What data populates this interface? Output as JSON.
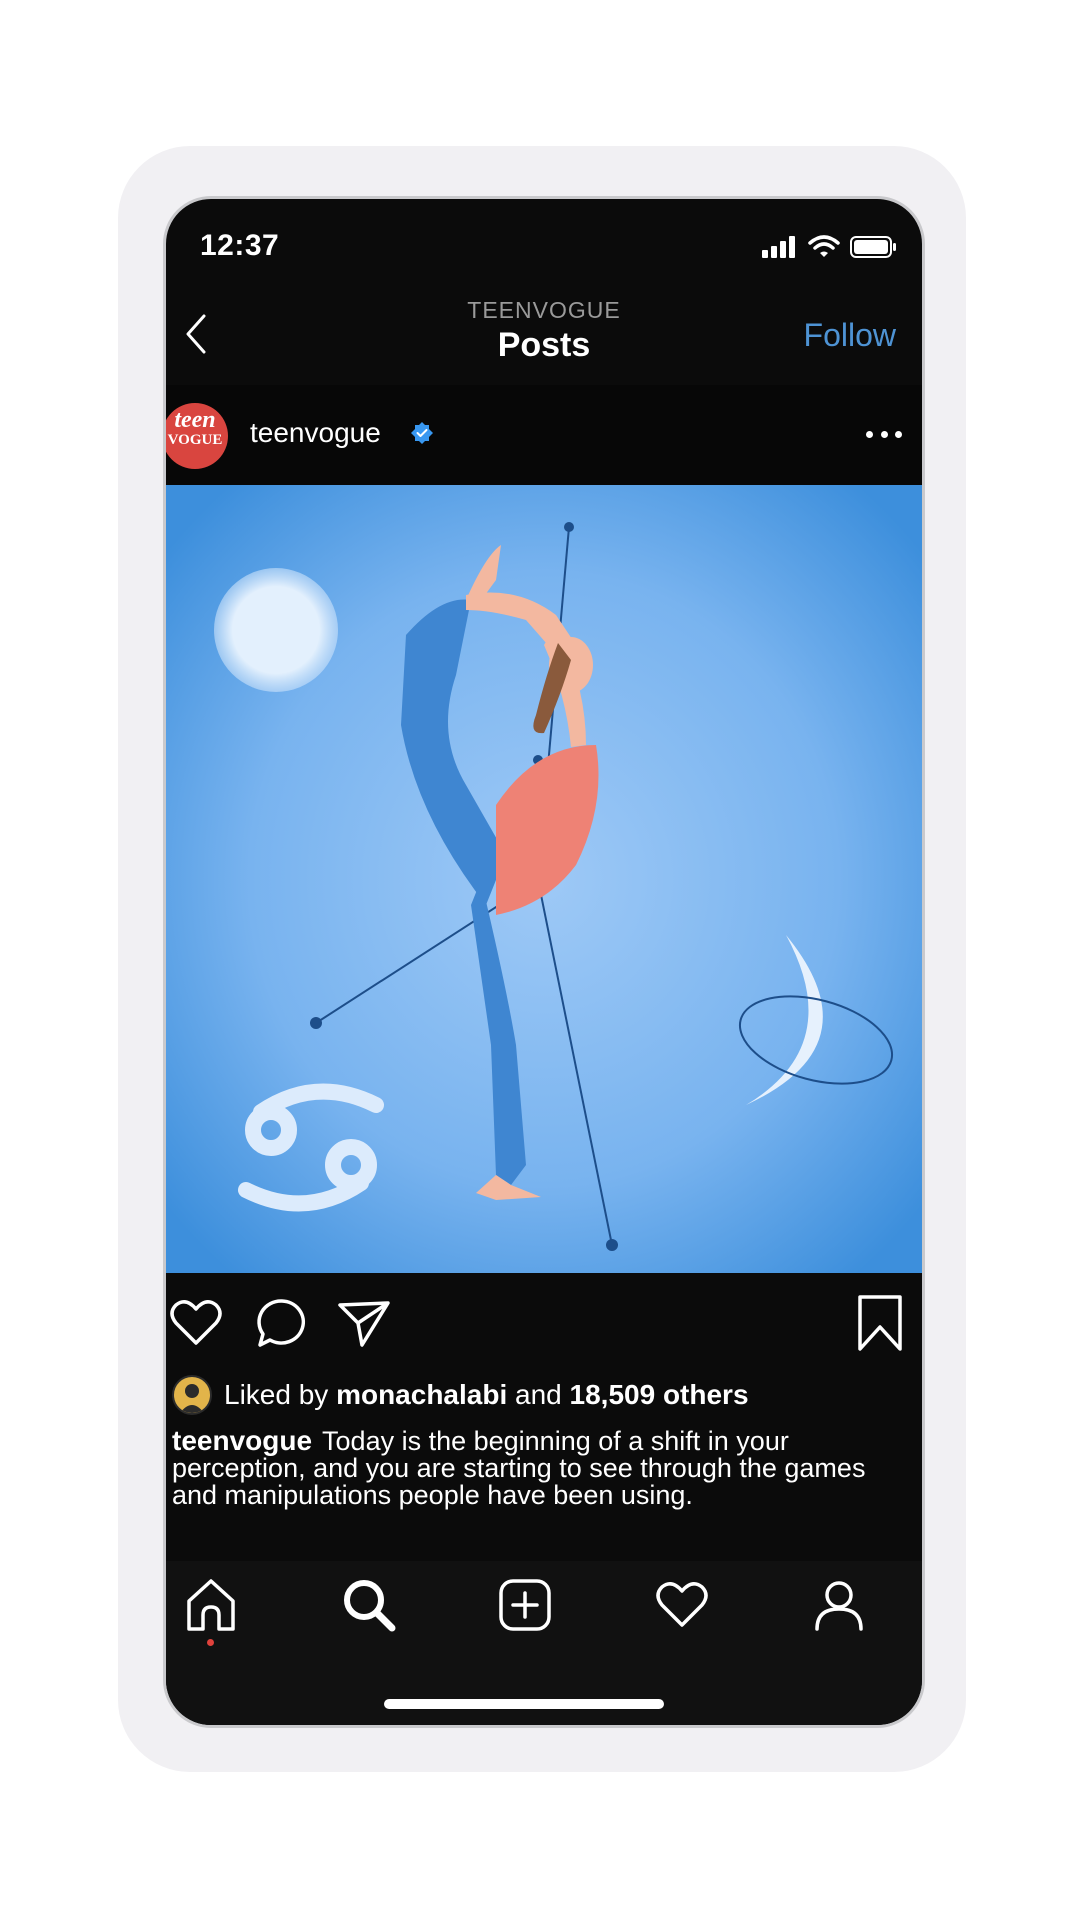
{
  "status_bar": {
    "time": "12:37"
  },
  "nav": {
    "account": "TEENVOGUE",
    "title": "Posts",
    "follow_label": "Follow"
  },
  "post": {
    "username": "teenvogue",
    "verified": true,
    "avatar_text_line1": "teen",
    "avatar_text_line2": "VOGUE",
    "likes": {
      "prefix": "Liked by",
      "liker": "monachalabi",
      "middle": "and",
      "count": "18,509 others"
    },
    "caption": {
      "author": "teenvogue",
      "text": "Today is the beginning of a shift in your perception, and you are starting to see through the games and manipulations people have been using."
    }
  },
  "icons": {
    "back": "chevron-left-icon",
    "more": "more-horizontal-icon",
    "like": "heart-icon",
    "comment": "comment-icon",
    "share": "paper-plane-icon",
    "save": "bookmark-icon",
    "home": "home-icon",
    "search": "search-icon",
    "create": "plus-square-icon",
    "activity": "heart-icon",
    "profile": "person-icon"
  },
  "colors": {
    "accent": "#4e93d4",
    "background": "#0b0b0b",
    "image_blue": "#5ea7ec",
    "notification_dot": "#e0423c"
  }
}
